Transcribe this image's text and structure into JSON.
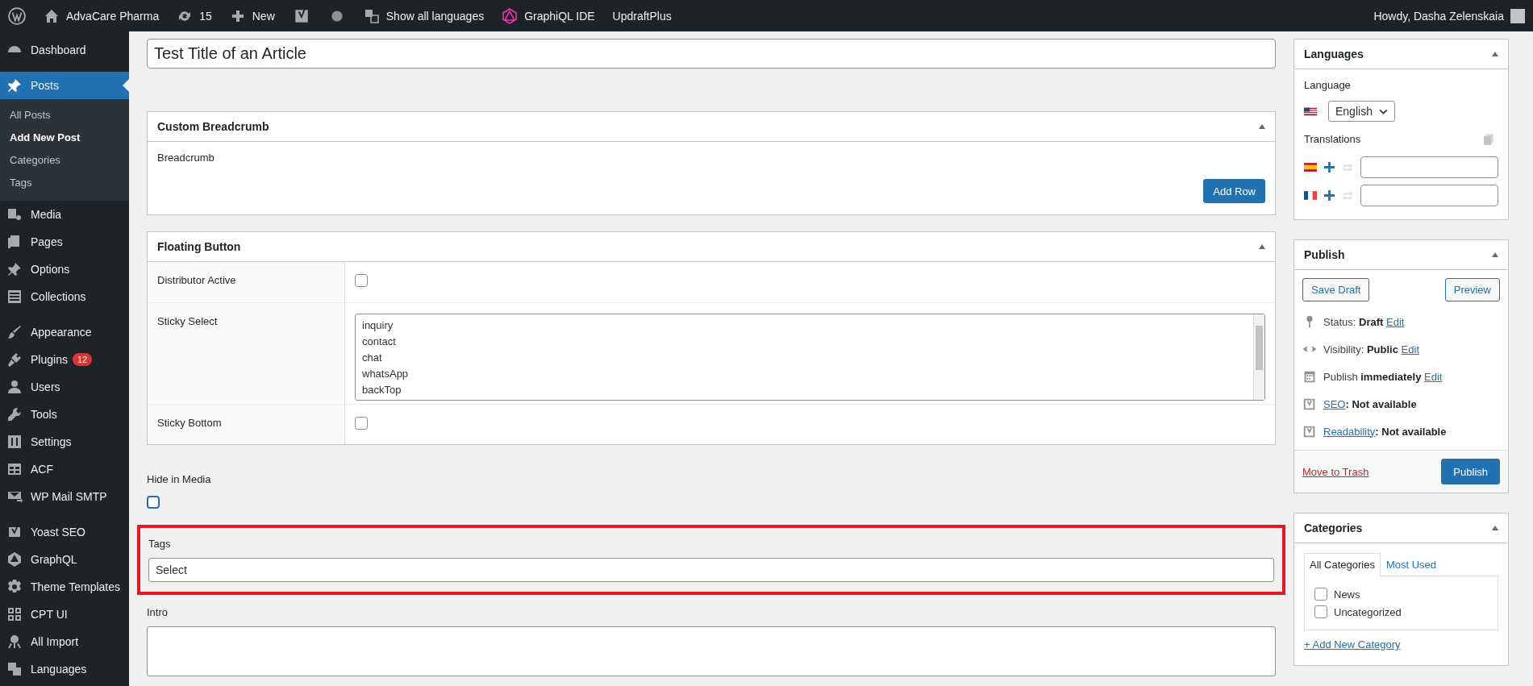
{
  "admin_bar": {
    "items": [
      {
        "kind": "logo"
      },
      {
        "kind": "home",
        "label": "AdvaCare Pharma"
      },
      {
        "kind": "updates",
        "label": "15"
      },
      {
        "kind": "new",
        "label": "New"
      },
      {
        "kind": "yoast"
      },
      {
        "kind": "dot"
      },
      {
        "kind": "translate",
        "label": "Show all languages"
      },
      {
        "kind": "graphql",
        "label": "GraphiQL IDE"
      },
      {
        "kind": "text",
        "label": "UpdraftPlus"
      }
    ],
    "greeting": "Howdy, Dasha Zelenskaia"
  },
  "sidebar": {
    "sections": [
      {
        "items": [
          {
            "label": "Dashboard",
            "selected": false
          }
        ]
      },
      {
        "items": [
          {
            "label": "Posts",
            "selected": true,
            "children": [
              {
                "label": "All Posts",
                "selected": false
              },
              {
                "label": "Add New Post",
                "selected": true
              },
              {
                "label": "Categories",
                "selected": false
              },
              {
                "label": "Tags",
                "selected": false
              }
            ]
          },
          {
            "label": "Media",
            "selected": false
          },
          {
            "label": "Pages",
            "selected": false
          },
          {
            "label": "Options",
            "selected": false
          },
          {
            "label": "Collections",
            "selected": false
          }
        ]
      },
      {
        "items": [
          {
            "label": "Appearance",
            "selected": false
          },
          {
            "label": "Plugins",
            "selected": false,
            "badge": "12"
          },
          {
            "label": "Users",
            "selected": false
          },
          {
            "label": "Tools",
            "selected": false
          },
          {
            "label": "Settings",
            "selected": false
          },
          {
            "label": "ACF",
            "selected": false
          },
          {
            "label": "WP Mail SMTP",
            "selected": false
          }
        ]
      },
      {
        "items": [
          {
            "label": "Yoast SEO",
            "selected": false
          },
          {
            "label": "GraphQL",
            "selected": false
          },
          {
            "label": "Theme Templates",
            "selected": false
          },
          {
            "label": "CPT UI",
            "selected": false
          },
          {
            "label": "All Import",
            "selected": false
          },
          {
            "label": "Languages",
            "selected": false
          }
        ]
      }
    ]
  },
  "title_field": {
    "value": "Test Title of an Article"
  },
  "breadcrumb_box": {
    "title": "Custom Breadcrumb",
    "label": "Breadcrumb",
    "button": "Add Row"
  },
  "floating_box": {
    "title": "Floating Button",
    "fields": [
      {
        "kind": "checkbox",
        "label": "Distributor Active",
        "checked": false
      },
      {
        "kind": "multiselect",
        "label": "Sticky Select",
        "options": [
          "inquiry",
          "contact",
          "chat",
          "whatsApp",
          "backTop"
        ]
      },
      {
        "kind": "checkbox",
        "label": "Sticky Bottom",
        "checked": false
      }
    ]
  },
  "hide_in_media": {
    "label": "Hide in Media",
    "checked": false
  },
  "tags": {
    "label": "Tags",
    "value": "Select",
    "highlighted": true
  },
  "intro": {
    "label": "Intro"
  },
  "languages_box": {
    "title": "Languages",
    "language_label": "Language",
    "language": "English",
    "translations_label": "Translations",
    "translations": [
      {
        "kind": "spanish"
      },
      {
        "kind": "french"
      }
    ]
  },
  "publish_box": {
    "title": "Publish",
    "save_draft": "Save Draft",
    "preview": "Preview",
    "rows": [
      {
        "kind": "status",
        "label": "Status:",
        "value": "Draft",
        "link": "Edit"
      },
      {
        "kind": "visibility",
        "label": "Visibility:",
        "value": "Public",
        "link": "Edit"
      },
      {
        "kind": "schedule",
        "label": "Publish",
        "value": "immediately",
        "link": "Edit"
      },
      {
        "kind": "seo",
        "link_first": "SEO",
        "value": ": Not available"
      },
      {
        "kind": "seo",
        "link_first": "Readability",
        "value": ": Not available"
      }
    ],
    "trash": "Move to Trash",
    "publish": "Publish"
  },
  "categories_box": {
    "title": "Categories",
    "tabs": [
      {
        "label": "All Categories",
        "selected": true
      },
      {
        "label": "Most Used",
        "selected": false
      }
    ],
    "items": [
      {
        "label": "News",
        "checked": false
      },
      {
        "label": "Uncategorized",
        "checked": false
      }
    ],
    "add_link": "+ Add New Category"
  }
}
